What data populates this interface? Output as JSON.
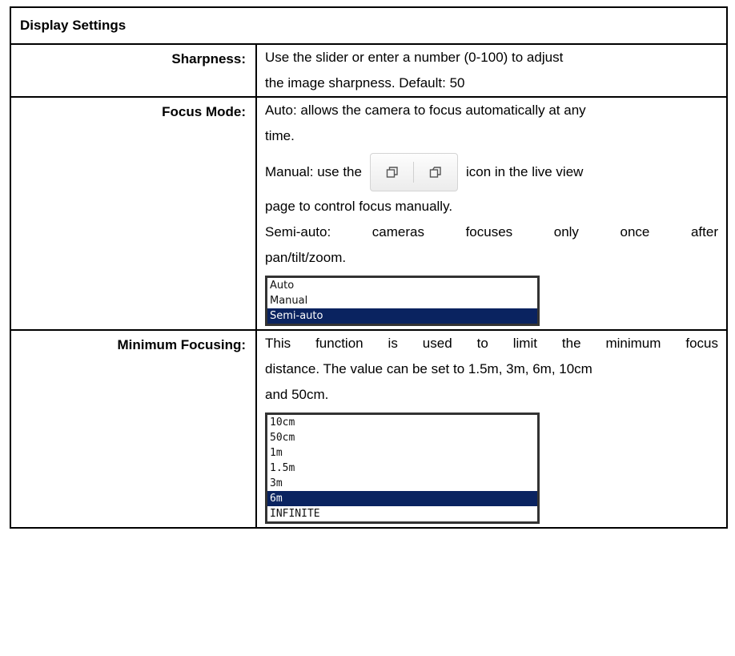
{
  "table": {
    "title": "Display Settings",
    "sharpness": {
      "label": "Sharpness:",
      "line1": "Use the slider or enter a number (0-100) to adjust",
      "line2": "the image sharpness. Default: 50"
    },
    "focus_mode": {
      "label": "Focus Mode:",
      "auto_line1": "Auto: allows the camera to focus automatically at any",
      "auto_line2": "time.",
      "manual_prefix": "Manual: use the",
      "manual_suffix": "icon in the live view",
      "manual_line2": "page to control focus manually.",
      "semi_line1": "Semi-auto: cameras focuses only once after",
      "semi_line2": "pan/tilt/zoom.",
      "icon_names": [
        "focus-near-icon",
        "focus-far-icon"
      ],
      "options": [
        "Auto",
        "Manual",
        "Semi-auto"
      ],
      "selected": "Semi-auto"
    },
    "minimum_focusing": {
      "label": "Minimum Focusing:",
      "line1": "This function is used to limit the minimum focus",
      "line2": "distance. The value can be set to 1.5m, 3m, 6m, 10cm",
      "line3": "and 50cm.",
      "options": [
        "10cm",
        "50cm",
        "1m",
        "1.5m",
        "3m",
        "6m",
        "INFINITE"
      ],
      "selected": "6m"
    }
  },
  "colors": {
    "selection_bg": "#0a2360",
    "border": "#000000"
  }
}
